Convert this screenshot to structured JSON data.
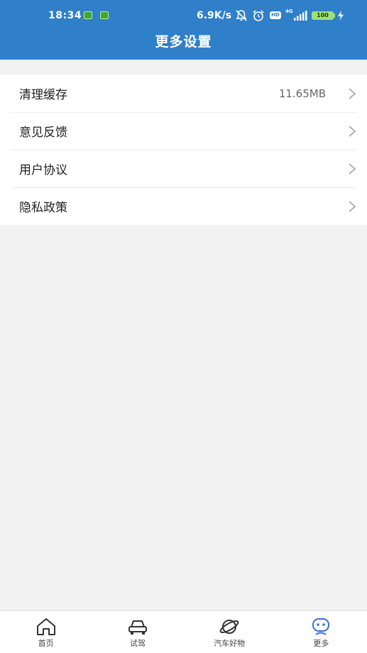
{
  "status_bar": {
    "time": "18:34",
    "speed": "6.9K/s",
    "hd": "HD",
    "network": "4G",
    "battery": "100"
  },
  "header": {
    "title": "更多设置"
  },
  "settings": {
    "items": [
      {
        "label": "清理缓存",
        "value": "11.65MB"
      },
      {
        "label": "意见反馈",
        "value": ""
      },
      {
        "label": "用户协议",
        "value": ""
      },
      {
        "label": "隐私政策",
        "value": ""
      }
    ]
  },
  "bottom_nav": {
    "items": [
      {
        "label": "首页",
        "icon": "home-icon"
      },
      {
        "label": "试驾",
        "icon": "car-icon"
      },
      {
        "label": "汽车好物",
        "icon": "planet-icon"
      },
      {
        "label": "更多",
        "icon": "robot-icon"
      }
    ],
    "active_index": 3,
    "active_color": "#3a6fd8"
  },
  "colors": {
    "header_bg": "#2f7fc9",
    "page_bg": "#f2f2f2"
  }
}
